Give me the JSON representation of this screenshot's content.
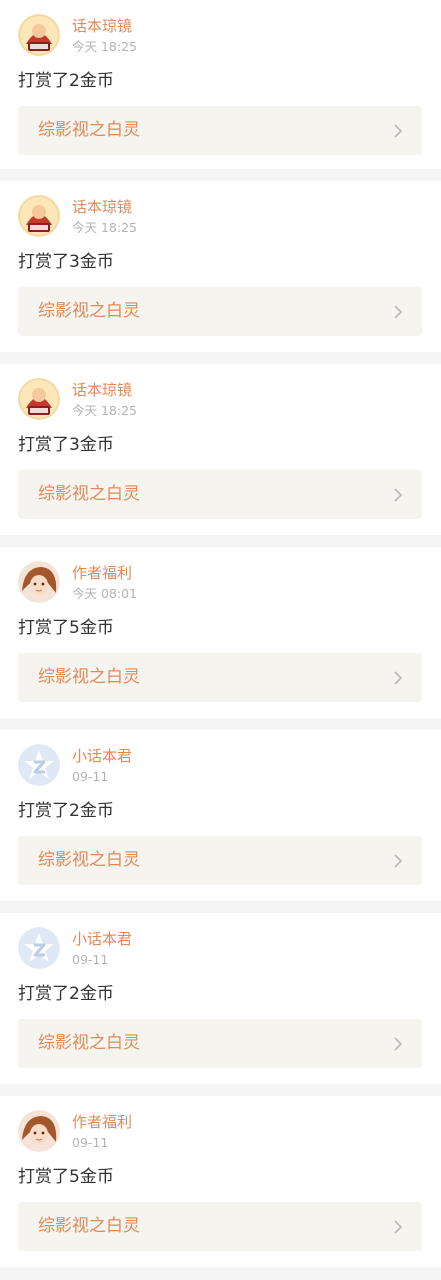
{
  "feed": {
    "items": [
      {
        "user_name": "话本琼镜",
        "time": "今天 18:25",
        "message": "打赏了2金币",
        "book_title": "综影视之白灵",
        "avatar_icon": "mascot-avatar-icon"
      },
      {
        "user_name": "话本琼镜",
        "time": "今天 18:25",
        "message": "打赏了3金币",
        "book_title": "综影视之白灵",
        "avatar_icon": "mascot-avatar-icon"
      },
      {
        "user_name": "话本琼镜",
        "time": "今天 18:25",
        "message": "打赏了3金币",
        "book_title": "综影视之白灵",
        "avatar_icon": "mascot-avatar-icon"
      },
      {
        "user_name": "作者福利",
        "time": "今天 08:01",
        "message": "打赏了5金币",
        "book_title": "综影视之白灵",
        "avatar_icon": "anime-girl-avatar-icon"
      },
      {
        "user_name": "小话本君",
        "time": "09-11",
        "message": "打赏了2金币",
        "book_title": "综影视之白灵",
        "avatar_icon": "default-star-avatar-icon"
      },
      {
        "user_name": "小话本君",
        "time": "09-11",
        "message": "打赏了2金币",
        "book_title": "综影视之白灵",
        "avatar_icon": "default-star-avatar-icon"
      },
      {
        "user_name": "作者福利",
        "time": "09-11",
        "message": "打赏了5金币",
        "book_title": "综影视之白灵",
        "avatar_icon": "anime-girl-avatar-icon"
      }
    ]
  },
  "colors": {
    "accent": "#e08a5a",
    "timestamp": "#b3b3b3",
    "message_text": "#333333",
    "book_link_bg": "#f6f4ee",
    "page_bg": "#f5f5f5"
  }
}
